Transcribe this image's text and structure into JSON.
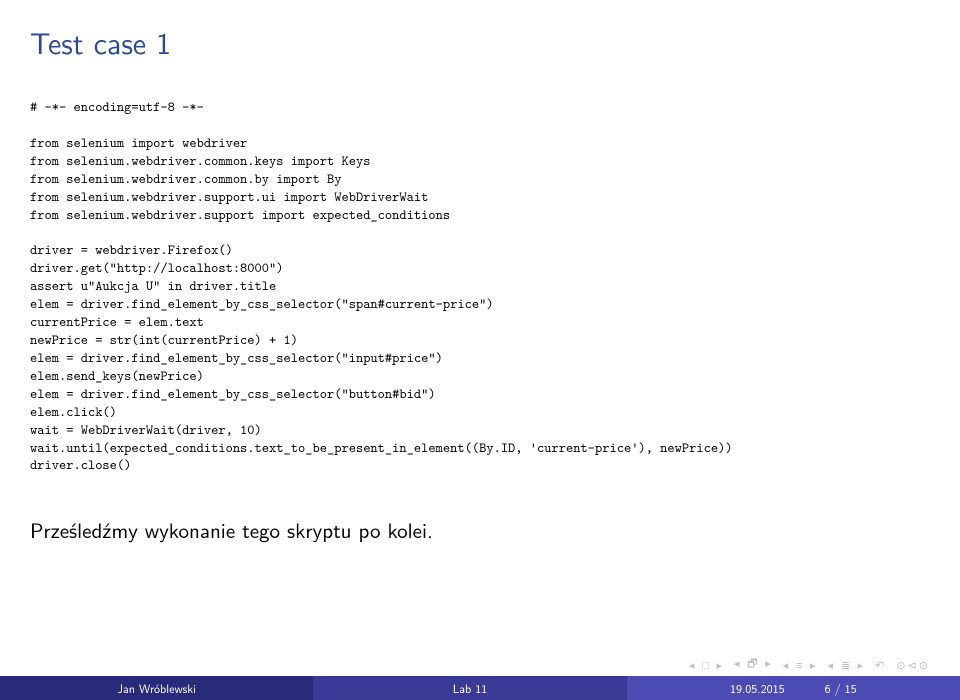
{
  "title": "Test case 1",
  "code": "# -*- encoding=utf-8 -*-\n\nfrom selenium import webdriver\nfrom selenium.webdriver.common.keys import Keys\nfrom selenium.webdriver.common.by import By\nfrom selenium.webdriver.support.ui import WebDriverWait\nfrom selenium.webdriver.support import expected_conditions\n\ndriver = webdriver.Firefox()\ndriver.get(\"http://localhost:8000\")\nassert u\"Aukcja U\" in driver.title\nelem = driver.find_element_by_css_selector(\"span#current-price\")\ncurrentPrice = elem.text\nnewPrice = str(int(currentPrice) + 1)\nelem = driver.find_element_by_css_selector(\"input#price\")\nelem.send_keys(newPrice)\nelem = driver.find_element_by_css_selector(\"button#bid\")\nelem.click()\nwait = WebDriverWait(driver, 10)\nwait.until(expected_conditions.text_to_be_present_in_element((By.ID, 'current-price'), newPrice))\ndriver.close()",
  "bodytext": "Prześledźmy wykonanie tego skryptu po kolei.",
  "nav": {
    "first": "◂ □ ▸",
    "sub": "◂ 🗗 ▸",
    "sec": "◂ ≡ ▸",
    "subsec": "◂ ≣ ▸",
    "back": "↶",
    "search": "⊙⊲⊙"
  },
  "footer": {
    "author": "Jan Wróblewski",
    "title": "Lab 11",
    "date": "19.05.2015",
    "page": "6 / 15"
  }
}
